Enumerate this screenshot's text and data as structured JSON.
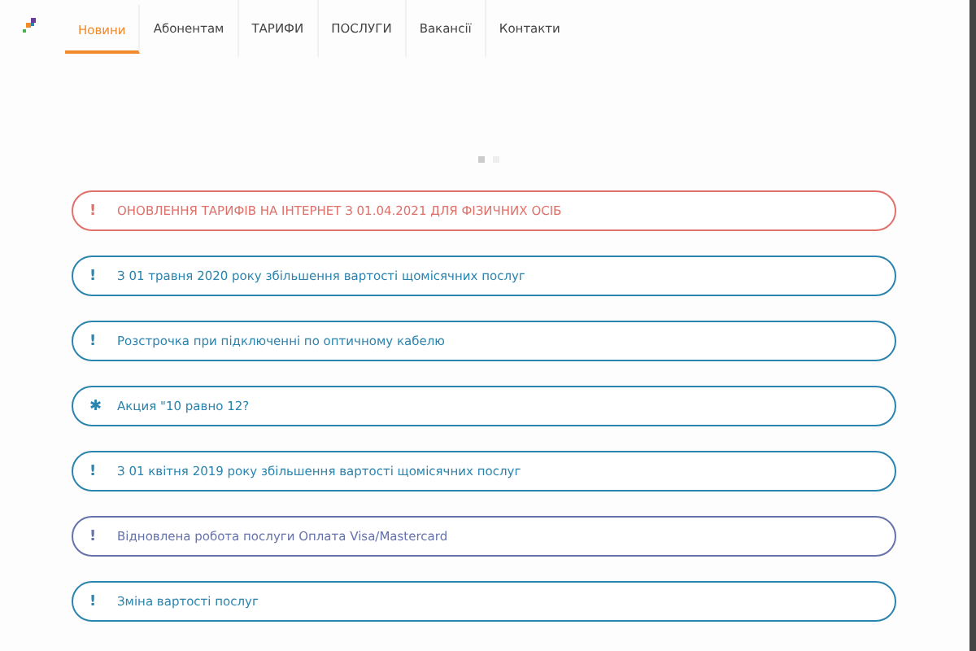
{
  "nav": {
    "items": [
      {
        "label": "Новини",
        "selected": true
      },
      {
        "label": "Абонентам",
        "selected": false
      },
      {
        "label": "ТАРИФИ",
        "selected": false
      },
      {
        "label": "ПОСЛУГИ",
        "selected": false
      },
      {
        "label": "Вакансії",
        "selected": false
      },
      {
        "label": "Контакти",
        "selected": false
      }
    ]
  },
  "slider_dots": [
    {
      "selected": true
    },
    {
      "selected": false
    }
  ],
  "news": [
    {
      "icon": "!",
      "text": "ОНОВЛЕННЯ ТАРИФІВ НА ІНТЕРНЕТ З 01.04.2021 ДЛЯ ФІЗИЧНИХ ОСІБ",
      "color": "#e0706a"
    },
    {
      "icon": "!",
      "text": "З 01 травня 2020 року збільшення вартості щомісячних послуг",
      "color": "#2a84ae"
    },
    {
      "icon": "!",
      "text": "Розстрочка при підключенні по оптичному кабелю",
      "color": "#2a84ae"
    },
    {
      "icon": "✱",
      "text": "Акция \"10 равно 12?",
      "color": "#2a84ae"
    },
    {
      "icon": "!",
      "text": "З 01 квітня 2019 року збільшення вартості щомісячних послуг",
      "color": "#2a84ae"
    },
    {
      "icon": "!",
      "text": "Відновлена робота послуги Оплата Visa/Mastercard",
      "color": "#6672aa"
    },
    {
      "icon": "!",
      "text": "Зміна вартості послуг",
      "color": "#2a84ae"
    }
  ]
}
